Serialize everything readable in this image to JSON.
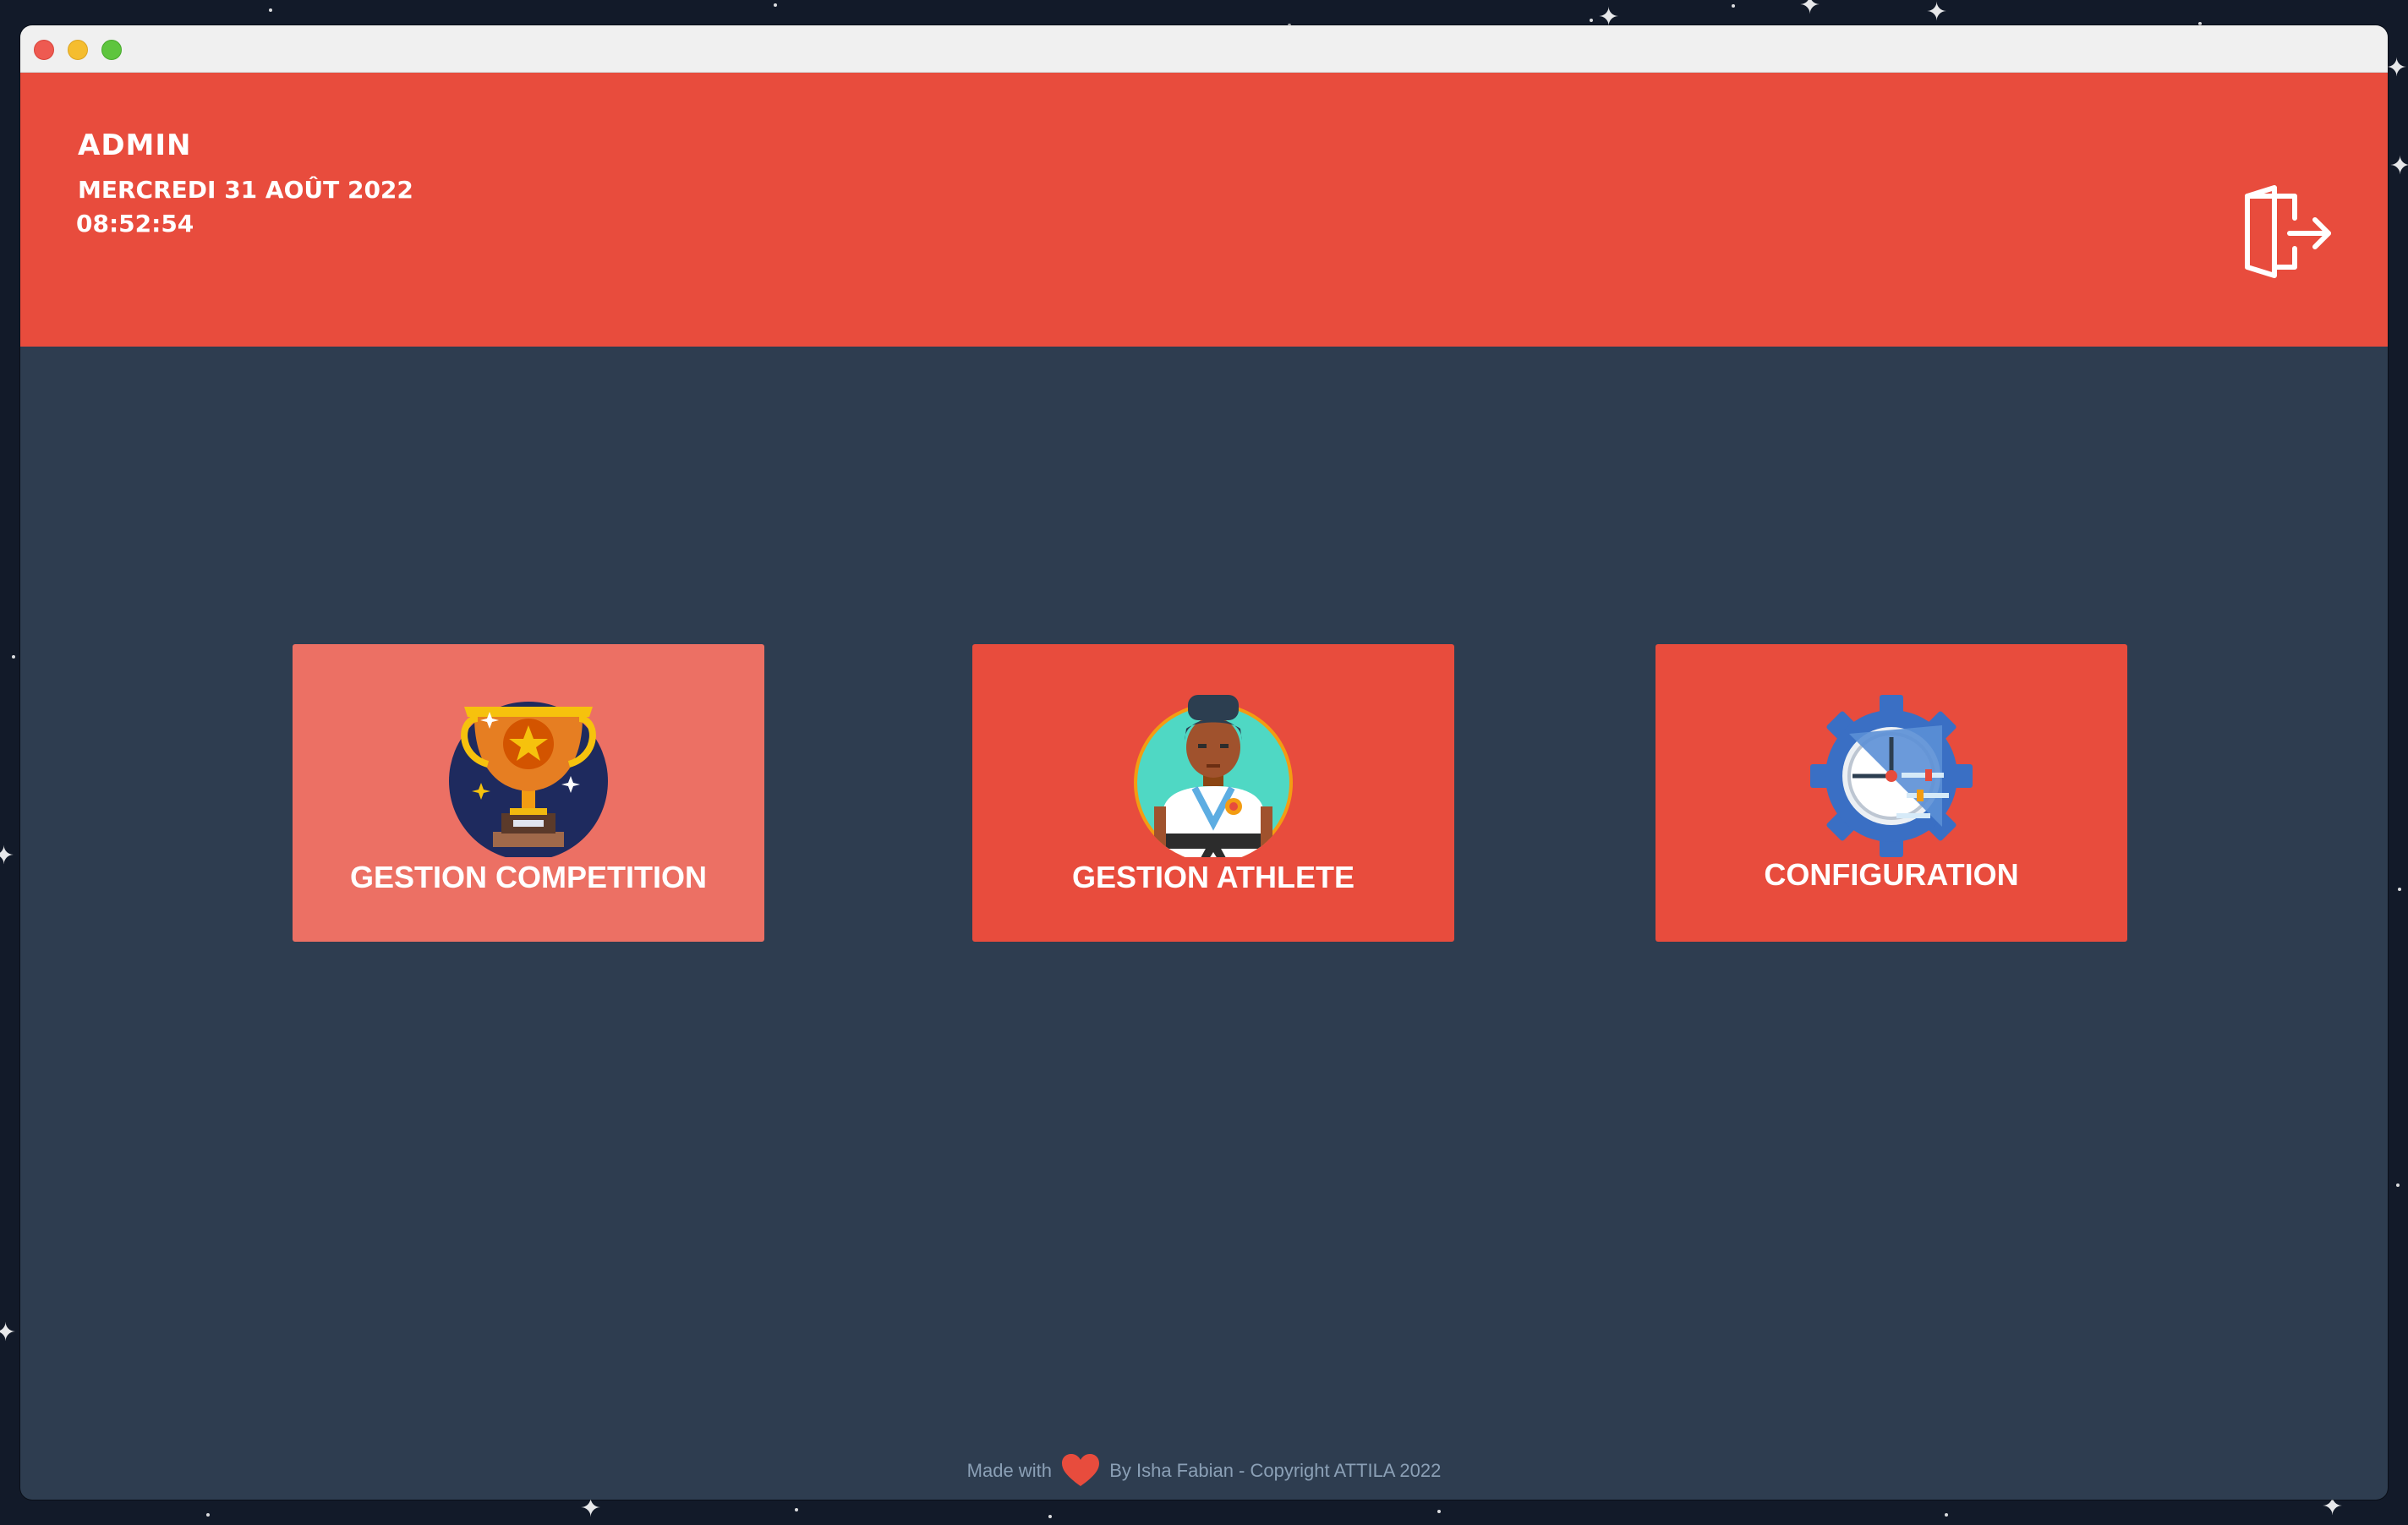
{
  "window": {
    "controls": [
      "close",
      "minimize",
      "zoom"
    ]
  },
  "header": {
    "user": "ADMIN",
    "date": "MERCREDI 31 AOÛT 2022",
    "time": "08:52:54",
    "logout_icon": "logout-door-icon",
    "color": "#e84c3d"
  },
  "tiles": [
    {
      "label": "GESTION COMPETITION",
      "icon": "trophy-icon",
      "color": "#ec7064",
      "state": "hover"
    },
    {
      "label": "GESTION ATHLETE",
      "icon": "athlete-karate-icon",
      "color": "#e84c3d"
    },
    {
      "label": "CONFIGURATION",
      "icon": "settings-gear-icon",
      "color": "#e84c3d"
    }
  ],
  "footer": {
    "made_with": "Made with",
    "heart_icon": "heart-icon",
    "credits": "By Isha Fabian - Copyright  ATTILA 2022"
  },
  "colors": {
    "background": "#2e3d50",
    "accent": "#e84c3d",
    "accent_light": "#ec7064",
    "footer_text": "#8ba0b6"
  }
}
